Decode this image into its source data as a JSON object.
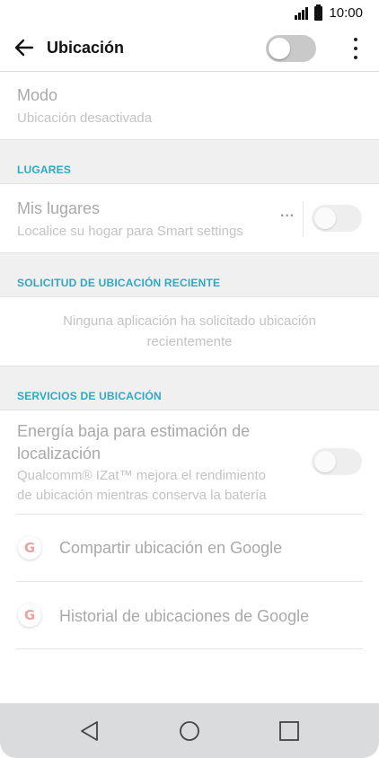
{
  "status_bar": {
    "time": "10:00"
  },
  "app_bar": {
    "title": "Ubicación",
    "location_toggle": "off",
    "icons": [
      "back-arrow-icon",
      "more-vert-icon"
    ]
  },
  "mode": {
    "title": "Modo",
    "subtitle": "Ubicación desactivada"
  },
  "places": {
    "header": "LUGARES",
    "item_title": "Mis lugares",
    "item_subtitle": "Localice su hogar para Smart settings",
    "more_label": "···",
    "toggle": "off"
  },
  "recent": {
    "header": "SOLICITUD DE UBICACIÓN RECIENTE",
    "empty_line1": "Ninguna aplicación ha solicitado ubicación",
    "empty_line2": "recientemente"
  },
  "services": {
    "header": "SERVICIOS DE UBICACIÓN",
    "low_energy_title_1": "Energía baja para estimación de",
    "low_energy_title_2": "localización",
    "low_energy_subtitle_1": "Qualcomm® IZat™ mejora el rendimiento",
    "low_energy_subtitle_2": "de ubicación mientras conserva la batería",
    "low_energy_toggle": "off",
    "google_share": "Compartir ubicación en Google",
    "google_history": "Historial de ubicaciones de Google",
    "google_icon_letter": "G"
  },
  "nav": {
    "icons": [
      "back-triangle-icon",
      "home-circle-icon",
      "recents-square-icon"
    ]
  },
  "colors": {
    "section_header": "#2fa8c5",
    "disabled_text": "#a9a9a9"
  }
}
